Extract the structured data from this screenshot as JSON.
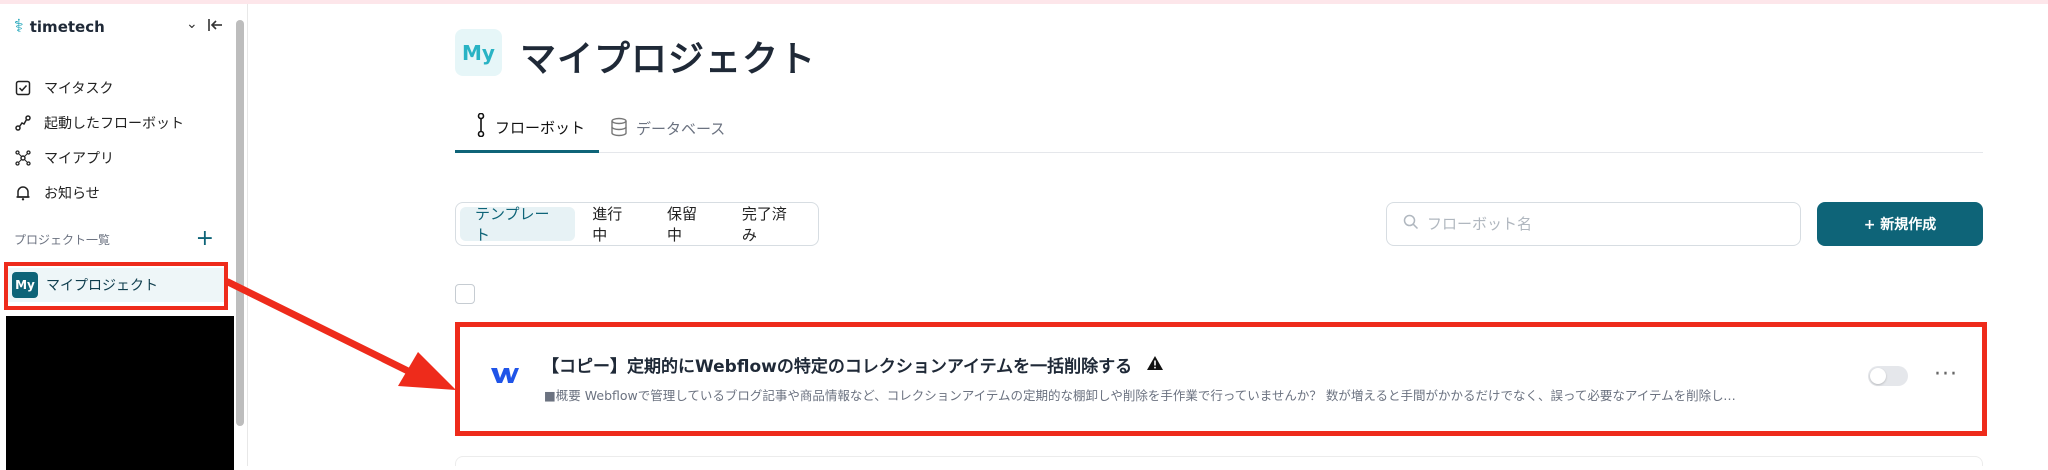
{
  "sidebar": {
    "brand": "timetech",
    "nav": [
      {
        "label": "マイタスク",
        "icon": "checkbox-icon"
      },
      {
        "label": "起動したフローボット",
        "icon": "flow-icon"
      },
      {
        "label": "マイアプリ",
        "icon": "apps-icon"
      },
      {
        "label": "お知らせ",
        "icon": "bell-icon"
      }
    ],
    "projects_heading": "プロジェクト一覧",
    "project_item": {
      "avatar": "My",
      "label": "マイプロジェクト"
    }
  },
  "page": {
    "avatar": "My",
    "title": "マイプロジェクト",
    "tabs": [
      {
        "label": "フローボット",
        "active": true,
        "icon": "flowbot-icon"
      },
      {
        "label": "データベース",
        "active": false,
        "icon": "database-icon"
      }
    ],
    "filters": [
      "テンプレート",
      "進行中",
      "保留中",
      "完了済み"
    ],
    "active_filter": "テンプレート",
    "search": {
      "placeholder": "フローボット名"
    },
    "new_button": "+ 新規作成"
  },
  "flowbots": [
    {
      "app_icon": "webflow-icon",
      "title": "【コピー】定期的にWebflowの特定のコレクションアイテムを一括削除する",
      "warning": true,
      "description": "■概要 Webflowで管理しているブログ記事や商品情報など、コレクションアイテムの定期的な棚卸しや削除を手作業で行っていませんか？ 数が増えると手間がかかるだけでなく、誤って必要なアイテムを削除してしまうリ...",
      "enabled": false
    }
  ],
  "colors": {
    "accent": "#0e6478",
    "highlight": "#ee2b1b"
  }
}
